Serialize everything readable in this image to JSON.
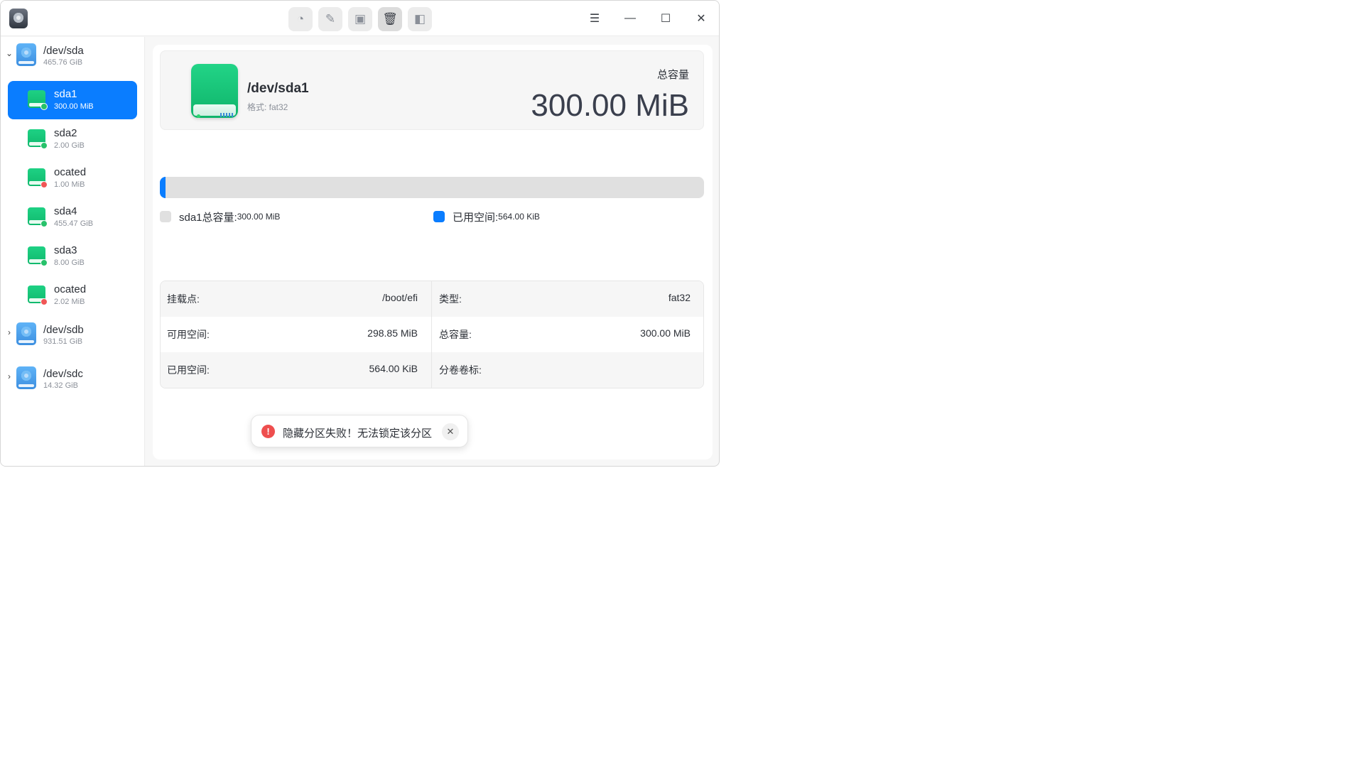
{
  "toolbar": {
    "buttons": [
      {
        "icon": "partition-pie-icon",
        "glyph": "◔"
      },
      {
        "icon": "wipe-broom-icon",
        "glyph": "✎"
      },
      {
        "icon": "mount-disk-icon",
        "glyph": "▣"
      },
      {
        "icon": "delete-trash-icon",
        "glyph": "🗑"
      },
      {
        "icon": "resize-icon",
        "glyph": "◧"
      }
    ]
  },
  "window_controls": {
    "menu": "☰",
    "minimize": "—",
    "maximize": "☐",
    "close": "✕"
  },
  "sidebar": {
    "disks": [
      {
        "name": "/dev/sda",
        "size": "465.76 GiB",
        "expanded": true,
        "caret": "⌄"
      },
      {
        "name": "/dev/sdb",
        "size": "931.51 GiB",
        "expanded": false,
        "caret": "›"
      },
      {
        "name": "/dev/sdc",
        "size": "14.32 GiB",
        "expanded": false,
        "caret": "›"
      }
    ],
    "partitions": [
      {
        "name": "sda1",
        "size": "300.00 MiB",
        "selected": true,
        "status": "ok"
      },
      {
        "name": "sda2",
        "size": "2.00 GiB",
        "selected": false,
        "status": "ok"
      },
      {
        "name": "ocated",
        "size": "1.00 MiB",
        "selected": false,
        "status": "error"
      },
      {
        "name": "sda4",
        "size": "455.47 GiB",
        "selected": false,
        "status": "ok"
      },
      {
        "name": "sda3",
        "size": "8.00 GiB",
        "selected": false,
        "status": "ok"
      },
      {
        "name": "ocated",
        "size": "2.02 MiB",
        "selected": false,
        "status": "error"
      }
    ]
  },
  "detail": {
    "device": "/dev/sda1",
    "format": "格式: fat32",
    "capacity_label": "总容量",
    "capacity_value": "300.00 MiB",
    "usage_fraction": 0.0018,
    "legend": {
      "total_label": "sda1总容量:",
      "total_value": "300.00 MiB",
      "used_label": "已用空间:",
      "used_value": "564.00 KiB"
    },
    "table": {
      "rows": [
        {
          "left_label": "挂载点:",
          "left_value": "/boot/efi",
          "right_label": "类型:",
          "right_value": "fat32"
        },
        {
          "left_label": "可用空间:",
          "left_value": "298.85 MiB",
          "right_label": "总容量:",
          "right_value": "300.00 MiB"
        },
        {
          "left_label": "已用空间:",
          "left_value": "564.00 KiB",
          "right_label": "分卷卷标:",
          "right_value": ""
        }
      ]
    }
  },
  "toast": {
    "message": "隐藏分区失败！无法锁定该分区",
    "icon": "!",
    "close": "✕"
  },
  "colors": {
    "accent": "#0a7dff",
    "partition_green": "#1ec97a",
    "error_red": "#ee4e4e",
    "bar_track": "#e0e0e0",
    "legend_total": "#e0e0e0"
  }
}
